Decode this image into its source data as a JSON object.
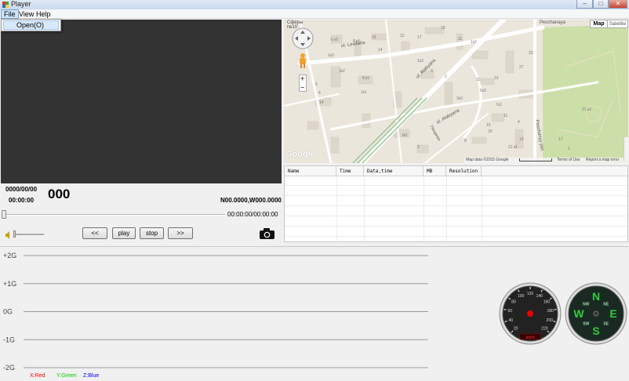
{
  "window": {
    "title": "Player",
    "min_glyph": "–",
    "max_glyph": "□",
    "close_glyph": "✕"
  },
  "menu": {
    "items": [
      "File",
      "View",
      "Help"
    ],
    "open_menu": {
      "items": [
        "Open(O)"
      ]
    }
  },
  "map": {
    "streets": [
      "Peschanaya",
      "ul. Levitana",
      "ul. Alabyana",
      "ul. Alabyana",
      "Peschanyy per.",
      "Пещаная"
    ],
    "labels": [
      "Сферы",
      "№10",
      "6 к5",
      "6 к1",
      "16",
      "14",
      "12",
      "17",
      "19",
      "11",
      "1к2",
      "1к3",
      "3к2",
      "5",
      "4",
      "14",
      "8 к1",
      "1к1",
      "1к3",
      "3",
      "2",
      "11",
      "19",
      "27",
      "23",
      "3к3",
      "5к3",
      "7к1",
      "11",
      "4",
      "15",
      "13",
      "3к1",
      "2",
      "8",
      "33",
      "21 к1",
      "21 к2",
      "17",
      "1"
    ],
    "map_types": [
      "Map",
      "Satellite"
    ],
    "zoom": [
      "+",
      "–"
    ],
    "attribution": "Map data ©2015 Google",
    "scale_text": "",
    "terms": "Terms of Use",
    "report": "Report a map error",
    "logo": "Google"
  },
  "table": {
    "columns": [
      "Name",
      "Time",
      "Data,time",
      "MB",
      "Resolution"
    ],
    "rows": []
  },
  "playback": {
    "date": "0000/00/00",
    "counter": "000",
    "time": "00:00:00",
    "coords": "N00.0000,W000.0000",
    "position": "00:00:00/00:00:00",
    "progress": 0,
    "volume": 0
  },
  "buttons": {
    "rewind": "<<",
    "play": "play",
    "stop": "stop",
    "forward": ">>"
  },
  "chart_data": {
    "type": "line",
    "yticks": [
      "+2G",
      "+1G",
      "0G",
      "-1G",
      "-2G"
    ],
    "yvalues": [
      2,
      1,
      0,
      -1,
      -2
    ],
    "ylim": [
      -2,
      2
    ],
    "grid": true,
    "series": [
      {
        "name": "X:Red",
        "color": "#ff0000",
        "values": []
      },
      {
        "name": "Y:Green",
        "color": "#00cc00",
        "values": []
      },
      {
        "name": "Z:Blue",
        "color": "#0000ff",
        "values": []
      }
    ]
  },
  "speedometer": {
    "ticks": [
      "20",
      "40",
      "60",
      "80",
      "100",
      "120",
      "140",
      "160",
      "180",
      "200",
      "220"
    ],
    "unit": "km/h",
    "value": 0
  },
  "compass": {
    "labels": [
      "N",
      "E",
      "S",
      "W",
      "NE",
      "SE",
      "SW",
      "NW"
    ],
    "heading": 0
  },
  "colors": {
    "video_bg": "#333333",
    "map_bg": "#ebe6dc",
    "park": "#cddfa8"
  }
}
